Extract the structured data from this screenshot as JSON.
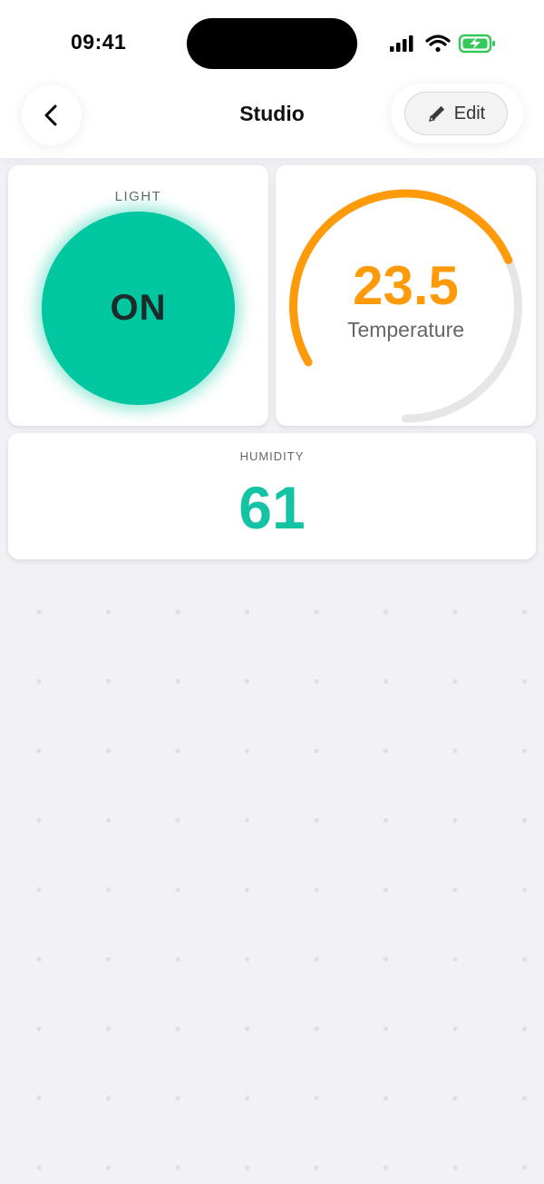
{
  "status_bar": {
    "time": "09:41",
    "icons": [
      "signal-icon",
      "wifi-icon",
      "battery-charging-icon"
    ]
  },
  "header": {
    "title": "Studio",
    "back_icon": "chevron-left-icon",
    "edit_label": "Edit",
    "edit_icon": "pencil-icon"
  },
  "widgets": {
    "light": {
      "title": "LIGHT",
      "state": "ON",
      "color": "#00c7a0"
    },
    "temperature": {
      "value": "23.5",
      "label": "Temperature",
      "fill_fraction": 0.62,
      "color": "#ff9a0a",
      "track_color": "#e6e6e6"
    },
    "humidity": {
      "title": "HUMIDITY",
      "value": "61",
      "color": "#14c3a4"
    }
  },
  "colors": {
    "background": "#f1f1f6",
    "card": "#ffffff"
  }
}
